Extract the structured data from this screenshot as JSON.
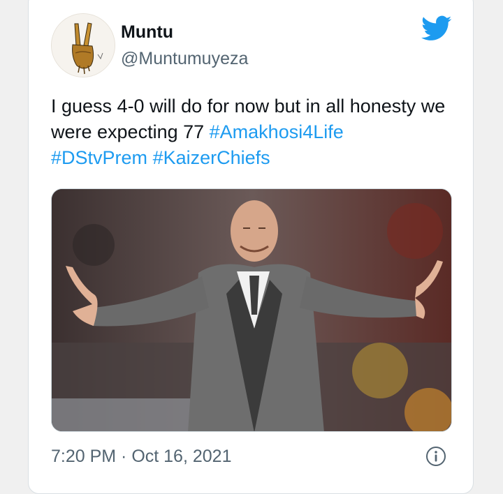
{
  "tweet": {
    "author_name": "Muntu",
    "author_handle": "@Muntumuyeza",
    "text_plain": "I guess 4-0 will do for now but in all honesty we were expecting 77 ",
    "hashtags": [
      "#Amakhosi4Life",
      "#DStvPrem",
      "#KaizerChiefs"
    ],
    "timestamp": "7:20 PM · Oct 16, 2021"
  },
  "icons": {
    "brand": "twitter-bird-icon",
    "info": "info-icon",
    "avatar": "peace-sign-hand-avatar"
  },
  "colors": {
    "link": "#1d9bf0",
    "text": "#0f1419",
    "muted": "#536471",
    "brand": "#1d9bf0"
  }
}
